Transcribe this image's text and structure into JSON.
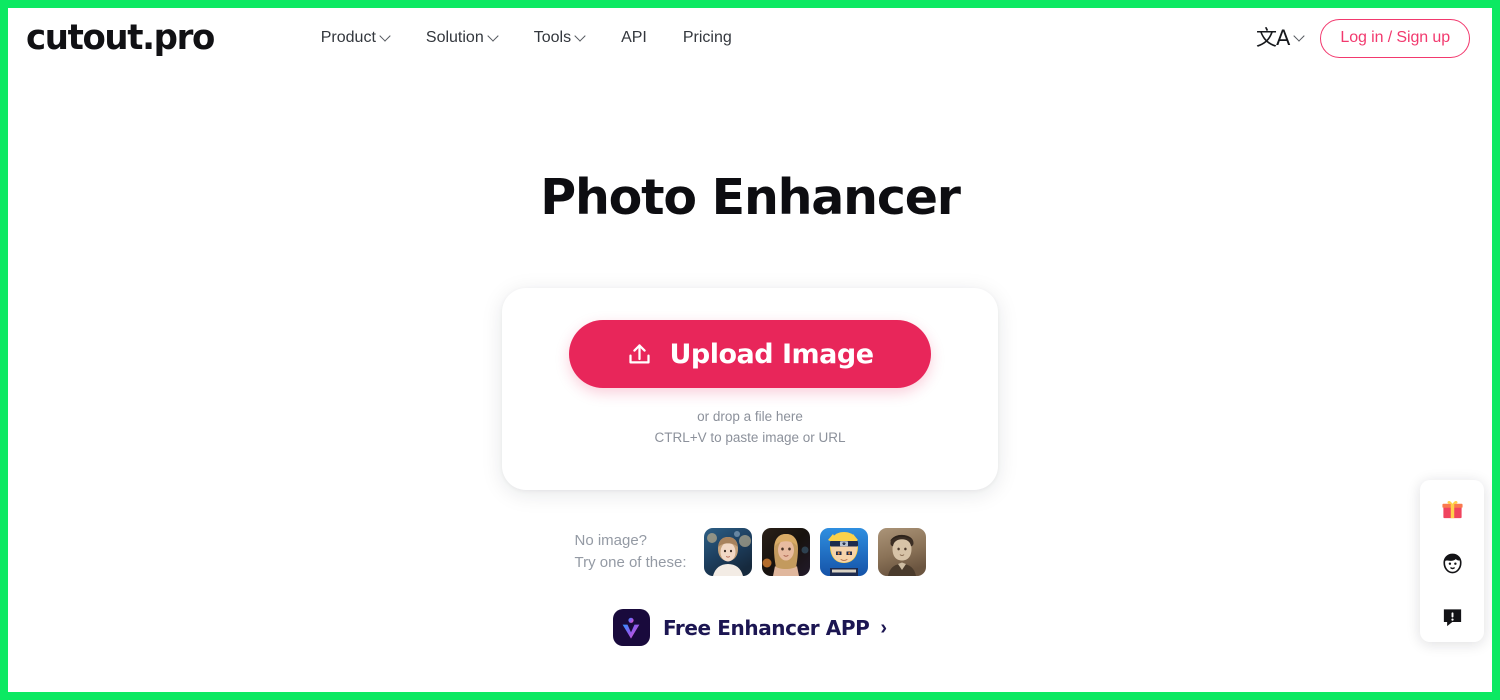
{
  "brand": {
    "logo_text": "cutout.pro",
    "accent_pink": "#f2396e",
    "accent_crimson": "#e8265a",
    "border_green": "#0ce962",
    "app_navy": "#1c1652"
  },
  "header": {
    "nav": [
      {
        "label": "Product",
        "has_caret": true
      },
      {
        "label": "Solution",
        "has_caret": true
      },
      {
        "label": "Tools",
        "has_caret": true
      },
      {
        "label": "API",
        "has_caret": false
      },
      {
        "label": "Pricing",
        "has_caret": false
      }
    ],
    "language": {
      "icon": "translate-icon",
      "glyph": "文A",
      "has_caret": true
    },
    "login_label": "Log in / Sign up"
  },
  "main": {
    "title": "Photo Enhancer",
    "upload": {
      "button_label": "Upload Image",
      "icon": "upload-icon",
      "hint_line1": "or drop a file here",
      "hint_line2": "CTRL+V to paste image or URL"
    },
    "samples": {
      "label_line1": "No image?",
      "label_line2": "Try one of these:",
      "thumbnails": [
        {
          "name": "sample-girl-bokeh",
          "alt": "young girl portrait with blue bokeh background"
        },
        {
          "name": "sample-blonde-woman",
          "alt": "blonde woman portrait in warm dark lighting"
        },
        {
          "name": "sample-anime-character",
          "alt": "anime character with spiky yellow hair and headband"
        },
        {
          "name": "sample-vintage-sepia",
          "alt": "sepia vintage portrait with hat"
        }
      ]
    },
    "app_promo": {
      "icon": "app-logo-icon",
      "label": "Free Enhancer APP",
      "arrow": "›"
    }
  },
  "float_panel": {
    "items": [
      {
        "name": "gift-icon",
        "label": "gift"
      },
      {
        "name": "face-icon",
        "label": "avatar"
      },
      {
        "name": "feedback-icon",
        "label": "feedback"
      }
    ]
  }
}
